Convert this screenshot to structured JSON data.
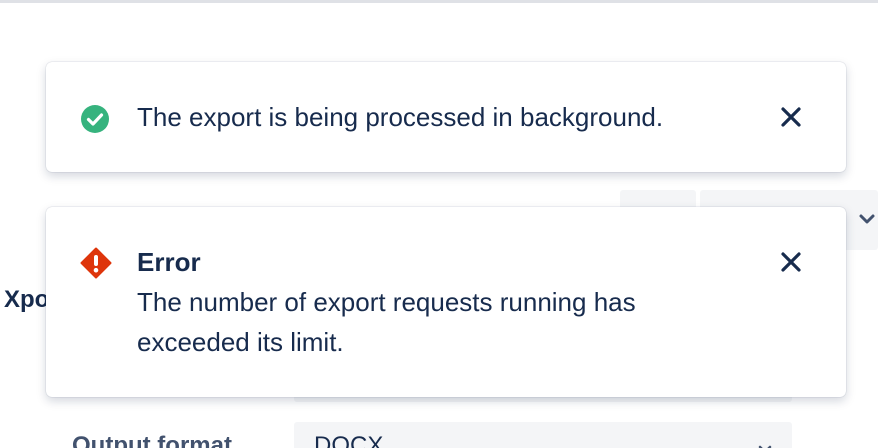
{
  "background": {
    "section_title": "Xpo",
    "output_format_label": "Output format",
    "output_format_value": "DOCX"
  },
  "flags": {
    "success": {
      "message": "The export is being processed in background.",
      "icon": "check-circle-icon",
      "color": "#36b37e"
    },
    "error": {
      "title": "Error",
      "message": "The number of export requests running has exceeded its limit.",
      "icon": "error-diamond-icon",
      "color": "#de350b"
    },
    "close_icon": "close-icon"
  },
  "colors": {
    "text": "#172b4d",
    "subtle_background": "#f4f5f7"
  }
}
